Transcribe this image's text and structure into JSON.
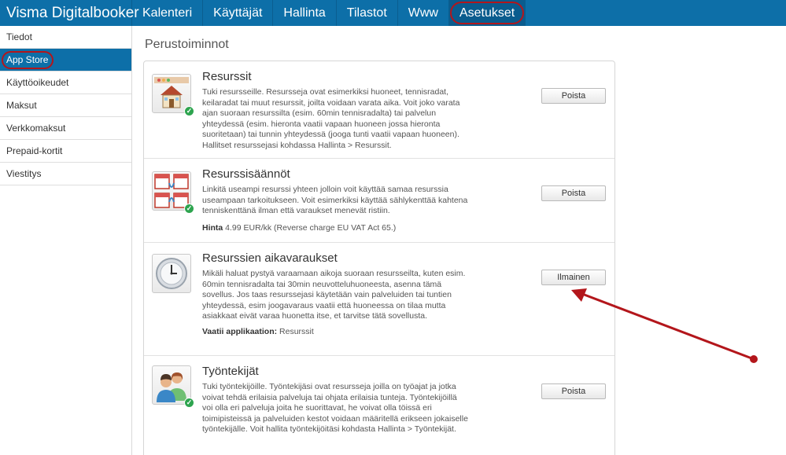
{
  "brand": "Visma Digitalbooker",
  "nav": [
    {
      "label": "Kalenteri"
    },
    {
      "label": "Käyttäjät"
    },
    {
      "label": "Hallinta"
    },
    {
      "label": "Tilastot"
    },
    {
      "label": "Www"
    },
    {
      "label": "Asetukset",
      "active": true
    }
  ],
  "sidebar": {
    "items": [
      {
        "label": "Tiedot"
      },
      {
        "label": "App Store",
        "active": true
      },
      {
        "label": "Käyttöoikeudet"
      },
      {
        "label": "Maksut"
      },
      {
        "label": "Verkkomaksut"
      },
      {
        "label": "Prepaid-kortit"
      },
      {
        "label": "Viestitys"
      }
    ]
  },
  "main": {
    "section_title": "Perustoiminnot",
    "apps": [
      {
        "title": "Resurssit",
        "icon": "house-icon",
        "installed": true,
        "desc": "Tuki resursseille. Resursseja ovat esimerkiksi huoneet, tennisradat, keilaradat tai muut resurssit, joilta voidaan varata aika. Voit joko varata ajan suoraan resurssilta (esim. 60min tennisradalta) tai palvelun yhteydessä (esim. hieronta vaatii vapaan huoneen jossa hieronta suoritetaan) tai tunnin yhteydessä (jooga tunti vaatii vapaan huoneen). Hallitset resurssejasi kohdassa Hallinta > Resurssit.",
        "button": "Poista"
      },
      {
        "title": "Resurssisäännöt",
        "icon": "linked-calendars-icon",
        "installed": true,
        "desc": "Linkitä useampi resurssi yhteen jolloin voit käyttää samaa resurssia useampaan tarkoitukseen. Voit esimerkiksi käyttää sählykenttää kahtena tenniskenttänä ilman että varaukset menevät ristiin.",
        "meta_label": "Hinta",
        "meta_value": "4.99 EUR/kk (Reverse charge EU VAT Act 65.)",
        "button": "Poista"
      },
      {
        "title": "Resurssien aikavaraukset",
        "icon": "clock-icon",
        "installed": false,
        "desc": "Mikäli haluat pystyä varaamaan aikoja suoraan resursseilta, kuten esim. 60min tennisradalta tai 30min neuvotteluhuoneesta, asenna tämä sovellus. Jos taas resurssejasi käytetään vain palveluiden tai tuntien yhteydessä, esim joogavaraus vaatii että huoneessa on tilaa mutta asiakkaat eivät varaa huonetta itse, et tarvitse tätä sovellusta.",
        "meta_label": "Vaatii applikaation:",
        "meta_value": "Resurssit",
        "button": "Ilmainen"
      },
      {
        "title": "Työntekijät",
        "icon": "employees-icon",
        "installed": true,
        "desc": "Tuki työntekijöille. Työntekijäsi ovat resursseja joilla on työajat ja jotka voivat tehdä erilaisia palveluja tai ohjata erilaisia tunteja. Työntekijöillä voi olla eri palveluja joita he suorittavat, he voivat olla töissä eri toimipisteissä ja palveluiden kestot voidaan määritellä erikseen jokaiselle työntekijälle. Voit hallita työntekijöitäsi kohdasta Hallinta > Työntekijät.",
        "button": "Poista"
      }
    ]
  },
  "colors": {
    "topbar": "#0d6fa8",
    "annotation": "#b3161b",
    "installed_check": "#2ea44f"
  }
}
